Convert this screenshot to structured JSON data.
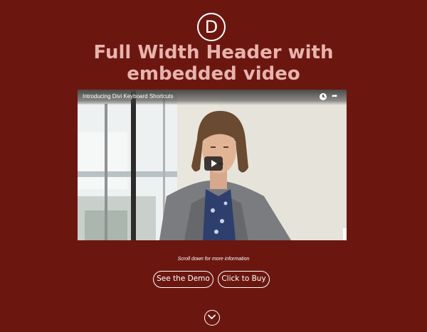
{
  "header": {
    "logo_letter": "D",
    "title_line1": "Full Width Header with",
    "title_line2": "embedded video"
  },
  "video": {
    "title": "Introducing Divi Keyboard Shortcuts",
    "icons": [
      "clock-icon",
      "share-icon",
      "play-icon"
    ]
  },
  "scroll_text": "Scroll down for more information",
  "buttons": {
    "demo": "See the Demo",
    "buy": "Click to Buy"
  },
  "scroll_icon": "chevron-down-circle-icon",
  "colors": {
    "background": "#6b1710",
    "title": "#e8b3ad",
    "text": "#ffffff"
  }
}
